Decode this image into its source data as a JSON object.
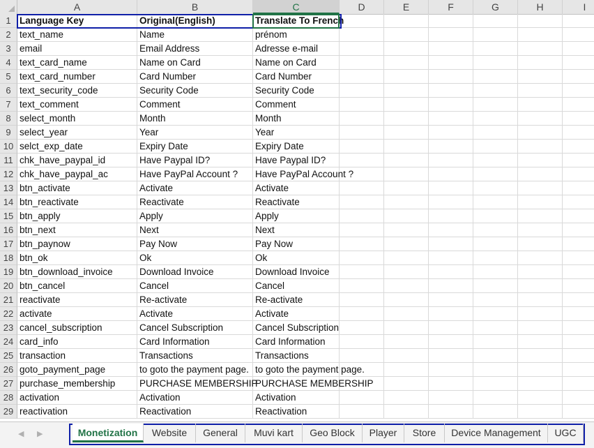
{
  "columns": [
    "A",
    "B",
    "C",
    "D",
    "E",
    "F",
    "G",
    "H",
    "I"
  ],
  "rows": [
    {
      "num": "1",
      "a": "Language Key",
      "b": "Original(English)",
      "c": "Translate To French"
    },
    {
      "num": "2",
      "a": "text_name",
      "b": "Name",
      "c": "prénom"
    },
    {
      "num": "3",
      "a": "email",
      "b": "Email Address",
      "c": "Adresse e-mail"
    },
    {
      "num": "4",
      "a": "text_card_name",
      "b": "Name on Card",
      "c": "Name on Card"
    },
    {
      "num": "5",
      "a": "text_card_number",
      "b": "Card Number",
      "c": "Card Number"
    },
    {
      "num": "6",
      "a": "text_security_code",
      "b": "Security Code",
      "c": "Security Code"
    },
    {
      "num": "7",
      "a": "text_comment",
      "b": "Comment",
      "c": "Comment"
    },
    {
      "num": "8",
      "a": "select_month",
      "b": "Month",
      "c": "Month"
    },
    {
      "num": "9",
      "a": "select_year",
      "b": "Year",
      "c": "Year"
    },
    {
      "num": "10",
      "a": "selct_exp_date",
      "b": "Expiry Date",
      "c": "Expiry Date"
    },
    {
      "num": "11",
      "a": "chk_have_paypal_id",
      "b": "Have Paypal ID?",
      "c": "Have Paypal ID?"
    },
    {
      "num": "12",
      "a": "chk_have_paypal_ac",
      "b": "Have PayPal Account ?",
      "c": "Have PayPal Account ?"
    },
    {
      "num": "13",
      "a": "btn_activate",
      "b": "Activate",
      "c": "Activate"
    },
    {
      "num": "14",
      "a": "btn_reactivate",
      "b": "Reactivate",
      "c": "Reactivate"
    },
    {
      "num": "15",
      "a": "btn_apply",
      "b": "Apply",
      "c": "Apply"
    },
    {
      "num": "16",
      "a": "btn_next",
      "b": "Next",
      "c": "Next"
    },
    {
      "num": "17",
      "a": "btn_paynow",
      "b": "Pay Now",
      "c": "Pay Now"
    },
    {
      "num": "18",
      "a": "btn_ok",
      "b": "Ok",
      "c": "Ok"
    },
    {
      "num": "19",
      "a": "btn_download_invoice",
      "b": "Download Invoice",
      "c": "Download Invoice"
    },
    {
      "num": "20",
      "a": "btn_cancel",
      "b": "Cancel",
      "c": "Cancel"
    },
    {
      "num": "21",
      "a": "reactivate",
      "b": "Re-activate",
      "c": "Re-activate"
    },
    {
      "num": "22",
      "a": "activate",
      "b": "Activate",
      "c": "Activate"
    },
    {
      "num": "23",
      "a": "cancel_subscription",
      "b": "Cancel Subscription",
      "c": "Cancel Subscription"
    },
    {
      "num": "24",
      "a": "card_info",
      "b": "Card Information",
      "c": "Card Information"
    },
    {
      "num": "25",
      "a": "transaction",
      "b": "Transactions",
      "c": "Transactions"
    },
    {
      "num": "26",
      "a": "goto_payment_page",
      "b": "to goto the payment page.",
      "c": "to goto the payment page."
    },
    {
      "num": "27",
      "a": "purchase_membership",
      "b": "PURCHASE MEMBERSHIP",
      "c": "PURCHASE MEMBERSHIP"
    },
    {
      "num": "28",
      "a": "activation",
      "b": "Activation",
      "c": "Activation"
    },
    {
      "num": "29",
      "a": "reactivation",
      "b": "Reactivation",
      "c": "Reactivation"
    }
  ],
  "sheet_tabs": [
    "Monetization",
    "Website",
    "General",
    "Muvi kart",
    "Geo Block",
    "Player",
    "Store",
    "Device Management",
    "UGC"
  ],
  "active_tab": "Monetization",
  "icons": {
    "prev_sheet": "◀",
    "next_sheet": "▶"
  },
  "colors": {
    "accent": "#217346",
    "highlight": "#0f1fa8"
  }
}
